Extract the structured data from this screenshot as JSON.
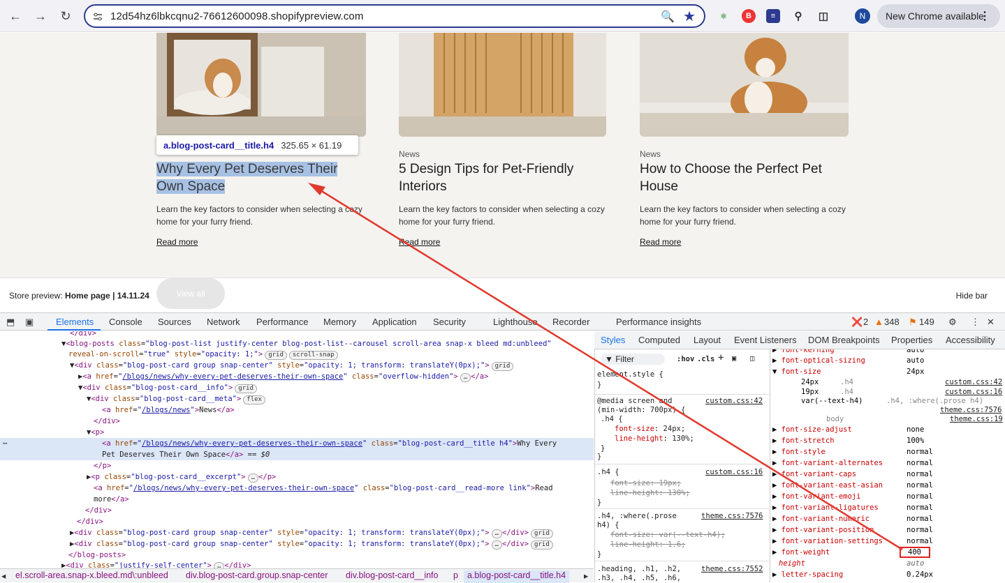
{
  "browser": {
    "url": "12d54hz6lbkcqnu2-76612600098.shopifypreview.com",
    "profile_initial": "N",
    "update_label": "New Chrome available"
  },
  "cards": [
    {
      "meta": "",
      "title": "Why Every Pet Deserves Their Own Space",
      "excerpt": "Learn the key factors to consider when selecting a cozy home for your furry friend.",
      "read_more": "Read more"
    },
    {
      "meta": "News",
      "title": "5 Design Tips for Pet-Friendly Interiors",
      "excerpt": "Learn the key factors to consider when selecting a cozy home for your furry friend.",
      "read_more": "Read more"
    },
    {
      "meta": "News",
      "title": "How to Choose the Perfect Pet House",
      "excerpt": "Learn the key factors to consider when selecting a cozy home for your furry friend.",
      "read_more": "Read more"
    }
  ],
  "tooltip": {
    "selector": "a.blog-post-card__title.h4",
    "dims": "325.65 × 61.19"
  },
  "store_bar": {
    "prefix": "Store preview: ",
    "page": "Home page | 14.11.24",
    "view_all": "View all",
    "hide": "Hide bar"
  },
  "devtools": {
    "tabs": [
      "Elements",
      "Console",
      "Sources",
      "Network",
      "Performance",
      "Memory",
      "Application",
      "Security",
      "Lighthouse",
      "Recorder",
      "Performance insights"
    ],
    "errors": "2",
    "warnings": "348",
    "issues": "149",
    "styles_tabs": [
      "Styles",
      "Computed",
      "Layout",
      "Event Listeners",
      "DOM Breakpoints",
      "Properties",
      "Accessibility"
    ],
    "filter_placeholder": "Filter",
    "hov": ":hov",
    "cls": ".cls",
    "breadcrumbs": [
      "el.scroll-area.snap-x.bleed.md\\:unbleed",
      "div.blog-post-card.group.snap-center",
      "div.blog-post-card__info",
      "p",
      "a.blog-post-card__title.h4"
    ]
  },
  "computed": [
    {
      "name": "font-kerning",
      "value": "auto"
    },
    {
      "name": "font-optical-sizing",
      "value": "auto"
    },
    {
      "name": "font-size",
      "value": "24px"
    },
    {
      "name": "font-size-adjust",
      "value": "none"
    },
    {
      "name": "font-stretch",
      "value": "100%"
    },
    {
      "name": "font-style",
      "value": "normal"
    },
    {
      "name": "font-variant-alternates",
      "value": "normal"
    },
    {
      "name": "font-variant-caps",
      "value": "normal"
    },
    {
      "name": "font-variant-east-asian",
      "value": "normal"
    },
    {
      "name": "font-variant-emoji",
      "value": "normal"
    },
    {
      "name": "font-variant-ligatures",
      "value": "normal"
    },
    {
      "name": "font-variant-numeric",
      "value": "normal"
    },
    {
      "name": "font-variant-position",
      "value": "normal"
    },
    {
      "name": "font-variation-settings",
      "value": "normal"
    },
    {
      "name": "font-weight",
      "value": "400"
    },
    {
      "name": "height",
      "value": "auto"
    },
    {
      "name": "letter-spacing",
      "value": "0.24px"
    }
  ],
  "font_size_trace": [
    {
      "value": "24px",
      "selector": ".h4",
      "source": "custom.css:42"
    },
    {
      "value": "19px",
      "selector": ".h4",
      "source": "custom.css:16"
    },
    {
      "value": "var(--text-h4)",
      "selector": ".h4, :where(.prose h4)",
      "source": "theme.css:7576"
    },
    {
      "value": "",
      "selector": "body",
      "source": "theme.css:19"
    }
  ]
}
